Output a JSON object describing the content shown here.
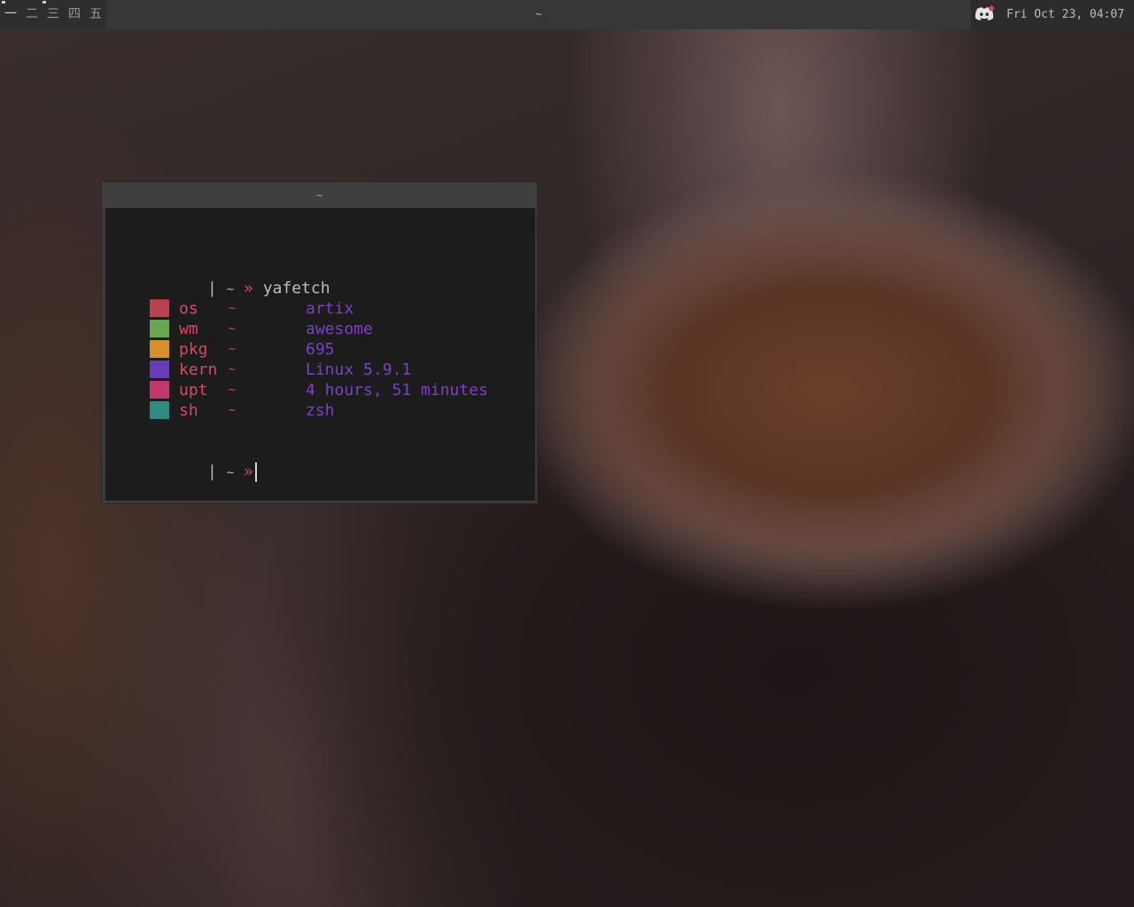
{
  "topbar": {
    "tags": [
      "一",
      "二",
      "三",
      "四",
      "五"
    ],
    "active_tag_index": 0,
    "title": "~",
    "clock": "Fri Oct 23, 04:07",
    "tray_icon": "discord-icon"
  },
  "terminal": {
    "title": "~",
    "prompt": {
      "bar": "|",
      "tilde": "~",
      "arrow": "»"
    },
    "command": "yafetch",
    "rows": [
      {
        "key": "os",
        "sep": "~",
        "value": "artix",
        "color": "#b8414f"
      },
      {
        "key": "wm",
        "sep": "~",
        "value": "awesome",
        "color": "#6aa84f"
      },
      {
        "key": "pkg",
        "sep": "~",
        "value": "695",
        "color": "#d6902a"
      },
      {
        "key": "kern",
        "sep": "~",
        "value": "Linux 5.9.1",
        "color": "#6a3bb8"
      },
      {
        "key": "upt",
        "sep": "~",
        "value": "4 hours, 51 minutes",
        "color": "#c2376c"
      },
      {
        "key": "sh",
        "sep": "~",
        "value": "zsh",
        "color": "#2f8a82"
      }
    ]
  },
  "colors": {
    "prompt_arrow": "#d0476f",
    "key_text": "#d34a66",
    "value_text": "#7d3fc4",
    "bar_bg": "#373737",
    "terminal_bg": "#1c1c1d"
  }
}
